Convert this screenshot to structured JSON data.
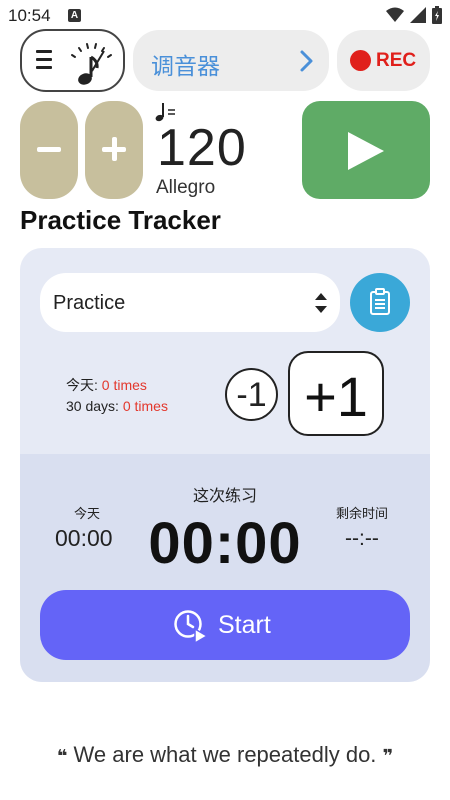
{
  "status_bar": {
    "time": "10:54",
    "badge": "A"
  },
  "top_bar": {
    "tuner_label": "调音器",
    "rec_label": "REC"
  },
  "tempo": {
    "bpm": "120",
    "name": "Allegro"
  },
  "practice_tracker": {
    "title": "Practice Tracker",
    "selected_item": "Practice",
    "today_label": "今天: ",
    "today_count": "0 times",
    "month_label": "30 days: ",
    "month_count": "0 times",
    "minus_one": "-1",
    "plus_one": "+1",
    "session_label": "这次练习",
    "today_short": "今天",
    "today_time": "00:00",
    "timer": "00:00",
    "remaining_label": "剩余时间",
    "remaining_value": "--:--",
    "start_label": "Start"
  },
  "quote": {
    "text": "We are what we repeatedly do."
  },
  "colors": {
    "accent_blue": "#4a90d9",
    "rec_red": "#e0201b",
    "tempo_btn": "#c7bf9d",
    "play_green": "#5fab66",
    "start_purple": "#6464f7",
    "clipboard_blue": "#3aa8d8",
    "count_red": "#e3382d"
  }
}
